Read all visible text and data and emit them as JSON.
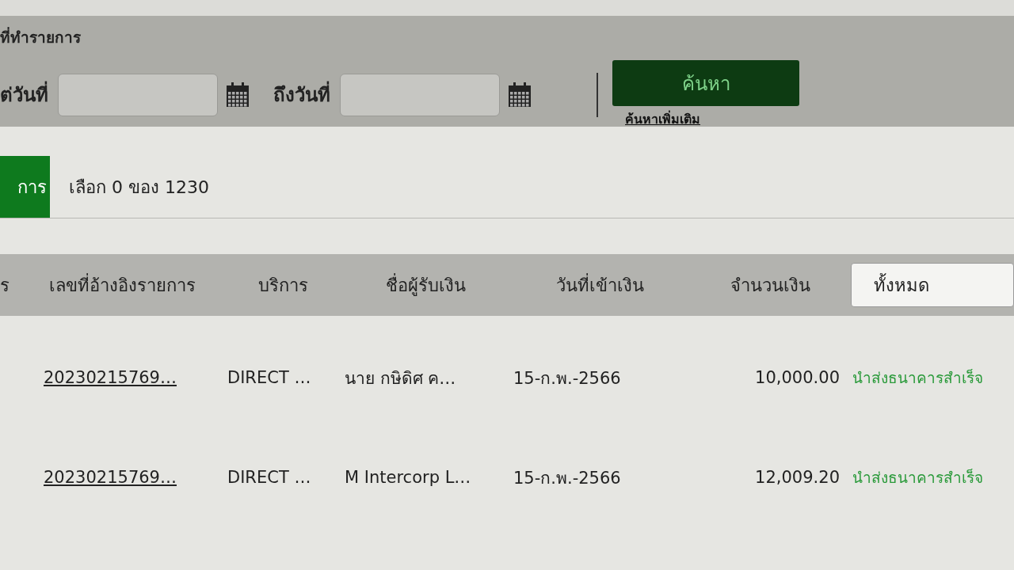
{
  "filter": {
    "title": "ที่ทำรายการ",
    "from_label": "ต่วันที่",
    "to_label": "ถึงวันที่",
    "search_button": "ค้นหา",
    "more_link": "ค้นหาเพิ่มเติม"
  },
  "selection": {
    "button": "การ",
    "summary": "เลือก 0 ของ 1230"
  },
  "table": {
    "columns": [
      "ร",
      "เลขที่อ้างอิงรายการ",
      "บริการ",
      "ชื่อผู้รับเงิน",
      "วันที่เข้าเงิน",
      "จำนวนเงิน"
    ],
    "status_filter": "ทั้งหมด",
    "rows": [
      {
        "reference": "20230215769…",
        "service": "DIRECT …",
        "payee": "นาย กษิดิศ ค…",
        "date": "15-ก.พ.-2566",
        "amount": "10,000.00",
        "status": "นำส่งธนาคารสำเร็จ"
      },
      {
        "reference": "20230215769…",
        "service": "DIRECT …",
        "payee": "M Intercorp L…",
        "date": "15-ก.พ.-2566",
        "amount": "12,009.20",
        "status": "นำส่งธนาคารสำเร็จ"
      }
    ]
  }
}
